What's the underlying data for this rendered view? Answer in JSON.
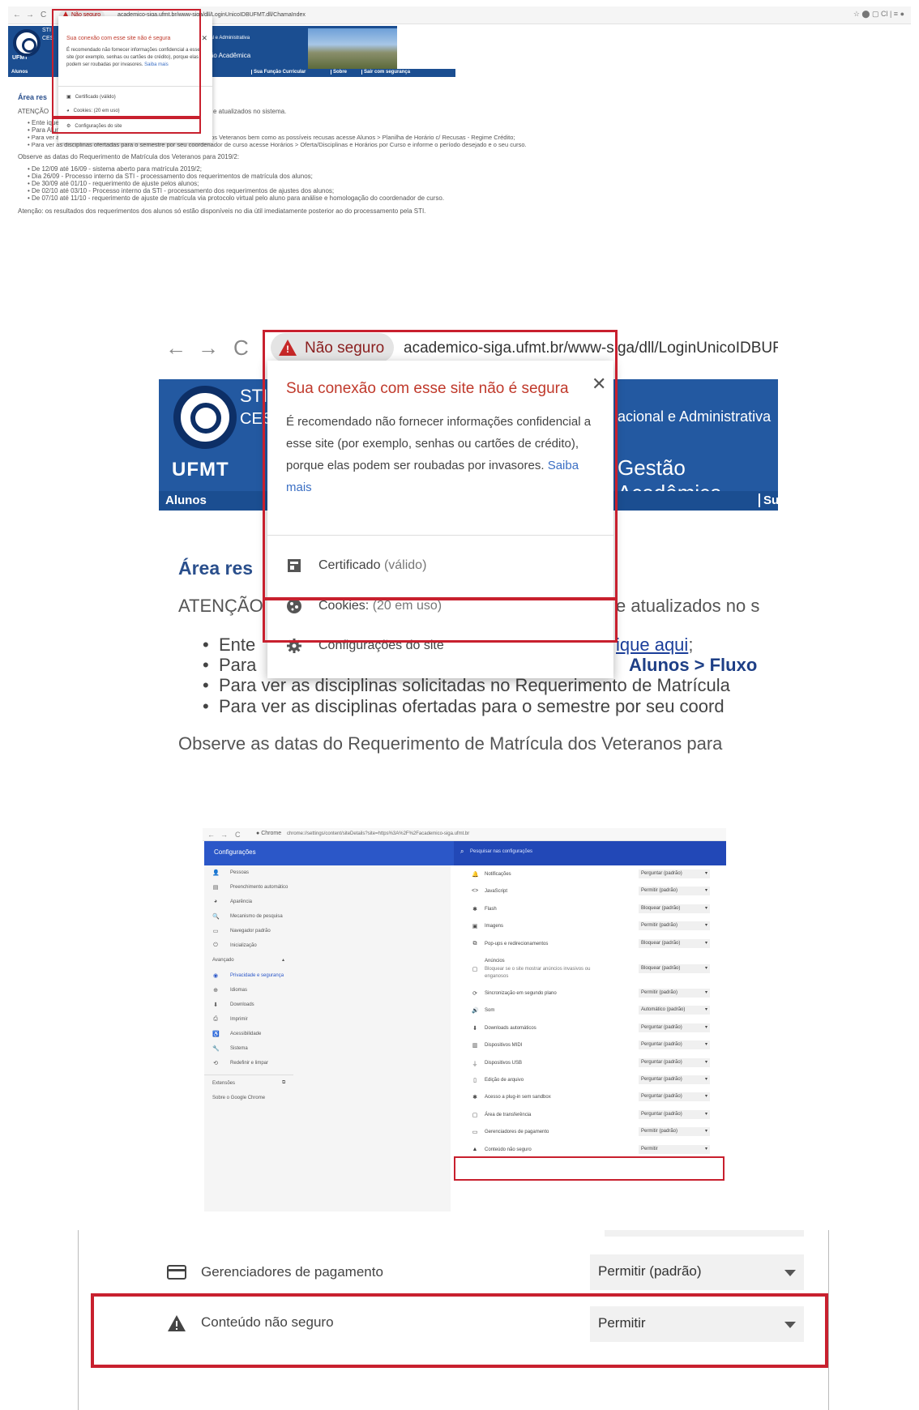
{
  "panel1": {
    "toolbar": {
      "nav": [
        "←",
        "→",
        "C"
      ],
      "not_secure": "Não seguro",
      "url": "academico-siga.ufmt.br/www-siga/dll/LoginUnicoIDBUFMT.dll/ChamaIndex",
      "right_icons": "☆  ⬤  ▢  Cl  |  ≡  ●"
    },
    "banner": {
      "sti": "STI",
      "ces": "CES",
      "ufmt": "UFMT",
      "admin": "cacional e Administrativa",
      "gestao": "Gestão Acadêmica"
    },
    "menubar": [
      "Alunos",
      "Sua Função Curricular",
      "Sobre",
      "Sair com segurança"
    ],
    "popup": {
      "title": "Sua conexão com esse site não é segura",
      "desc": "É recomendado não fornecer informações confidencial a esse site (por exemplo, senhas ou cartões de crédito), porque elas podem ser roubadas por invasores.",
      "more": "Saiba mais",
      "cert": "Certificado (válido)",
      "cookies": "Cookies: (20 em uso)",
      "settings": "Configurações do site"
    },
    "heading": "Área res",
    "atencao": "ATENÇÃO",
    "atencao_tail": "e atualizados no sistema.",
    "bullets": [
      "Ente                                       ique aqui;",
      "Para                                       Alunos > Fluxograma;",
      "Para ver as disciplinas solicitadas no Requerimento de Matrícula dos Veteranos bem como as possíveis recusas acesse Alunos > Planilha de Horário c/ Recusas - Regime Crédito;",
      "Para ver as disciplinas ofertadas para o semestre por seu coordenador de curso acesse Horários > Oferta/Disciplinas e Horários por Curso e informe o período desejado e o seu curso."
    ],
    "observe": "Observe as datas do Requerimento de Matrícula dos Veteranos para 2019/2:",
    "dates": [
      "De 12/09 até 16/09 - sistema aberto para matrícula 2019/2;",
      "Dia 26/09 - Processo interno da STI - processamento dos requerimentos de matrícula dos alunos;",
      "De 30/09 até 01/10 - requerimento de ajuste pelos alunos;",
      "De 02/10 até 03/10 - Processo interno da STI - processamento dos requerimentos de ajustes dos alunos;",
      "De 07/10 até 11/10 - requerimento de ajuste de matrícula via protocolo virtual pelo aluno para análise e homologação do coordenador de curso."
    ],
    "footer": "Atenção: os resultados dos requerimentos dos alunos só estão disponíveis no dia útil imediatamente posterior ao do processamento pela STI."
  },
  "panel2": {
    "nav": [
      "←",
      "→",
      "C"
    ],
    "not_secure": "Não seguro",
    "url": "academico-siga.ufmt.br/www-siga/dll/LoginUnicoIDBUF",
    "banner": {
      "sti": "STI",
      "ces": "CES",
      "ufmt": "UFMT",
      "admin": "acional e Administrativa",
      "gestao": "Gestão Acadêmica",
      "alunos": "Alunos",
      "su": "Su"
    },
    "popup": {
      "title": "Sua conexão com esse site não é segura",
      "desc": "É recomendado não fornecer informações confidencial a esse site (por exemplo, senhas ou cartões de crédito), porque elas podem ser roubadas por invasores.",
      "more": "Saiba mais",
      "cert_label": "Certificado",
      "cert_status": "(válido)",
      "cookies_label": "Cookies:",
      "cookies_status": "(20 em uso)",
      "settings": "Configurações do site"
    },
    "heading": "Área res",
    "atencao": "ATENÇÃO",
    "atencao_tail": "e atualizados no s",
    "bullet1_start": "Ente",
    "bullet1_link": "ique aqui",
    "bullet1_end": ";",
    "bullet2_start": "Para",
    "bullet2_bold": "Alunos > Fluxo",
    "bullet3": "Para ver as disciplinas solicitadas no Requerimento de Matrícula",
    "bullet4": "Para ver as disciplinas ofertadas para o semestre por seu coord",
    "observe": "Observe as datas do Requerimento de Matrícula dos Veteranos para"
  },
  "panel3": {
    "toolbar": {
      "nav": [
        "←",
        "→",
        "C"
      ],
      "chrome": "Chrome",
      "url": "chrome://settings/content/siteDetails?site=https%3A%2F%2Facademico-siga.ufmt.br"
    },
    "title": "Configurações",
    "search_placeholder": "Pesquisar nas configurações",
    "sidebar": [
      {
        "icon": "person-icon",
        "glyph": "👤",
        "label": "Pessoas"
      },
      {
        "icon": "autofill-icon",
        "glyph": "▤",
        "label": "Preenchimento automático"
      },
      {
        "icon": "palette-icon",
        "glyph": "◕",
        "label": "Aparência"
      },
      {
        "icon": "search-icon",
        "glyph": "🔍",
        "label": "Mecanismo de pesquisa"
      },
      {
        "icon": "browser-icon",
        "glyph": "▭",
        "label": "Navegador padrão"
      },
      {
        "icon": "power-icon",
        "glyph": "⏻",
        "label": "Inicialização"
      }
    ],
    "advanced": "Avançado",
    "advanced_items": [
      {
        "icon": "shield-icon",
        "glyph": "◉",
        "label": "Privacidade e segurança",
        "active": true
      },
      {
        "icon": "globe-icon",
        "glyph": "⊕",
        "label": "Idiomas"
      },
      {
        "icon": "download-icon",
        "glyph": "⬇",
        "label": "Downloads"
      },
      {
        "icon": "print-icon",
        "glyph": "⎙",
        "label": "Imprimir"
      },
      {
        "icon": "accessibility-icon",
        "glyph": "♿",
        "label": "Acessibilidade"
      },
      {
        "icon": "wrench-icon",
        "glyph": "🔧",
        "label": "Sistema"
      },
      {
        "icon": "restore-icon",
        "glyph": "⟲",
        "label": "Redefinir e limpar"
      }
    ],
    "extensions": "Extensões",
    "about": "Sobre o Google Chrome",
    "permissions": [
      {
        "icon": "bell-icon",
        "glyph": "🔔",
        "label": "Notificações",
        "value": "Perguntar (padrão)"
      },
      {
        "icon": "code-icon",
        "glyph": "<>",
        "label": "JavaScript",
        "value": "Permitir (padrão)"
      },
      {
        "icon": "puzzle-icon",
        "glyph": "✱",
        "label": "Flash",
        "value": "Bloquear (padrão)"
      },
      {
        "icon": "image-icon",
        "glyph": "▣",
        "label": "Imagens",
        "value": "Permitir (padrão)"
      },
      {
        "icon": "popup-icon",
        "glyph": "⧉",
        "label": "Pop-ups e redirecionamentos",
        "value": "Bloquear (padrão)"
      },
      {
        "icon": "ads-icon",
        "glyph": "▢",
        "label": "Anúncios",
        "sublabel": "Bloquear se o site mostrar anúncios invasivos ou enganosos",
        "value": "Bloquear (padrão)"
      },
      {
        "icon": "sync-icon",
        "glyph": "⟳",
        "label": "Sincronização em segundo plano",
        "value": "Permitir (padrão)"
      },
      {
        "icon": "sound-icon",
        "glyph": "🔊",
        "label": "Som",
        "value": "Automático (padrão)"
      },
      {
        "icon": "download-icon",
        "glyph": "⬇",
        "label": "Downloads automáticos",
        "value": "Perguntar (padrão)"
      },
      {
        "icon": "midi-icon",
        "glyph": "▥",
        "label": "Dispositivos MIDI",
        "value": "Perguntar (padrão)"
      },
      {
        "icon": "usb-icon",
        "glyph": "⏚",
        "label": "Dispositivos USB",
        "value": "Perguntar (padrão)"
      },
      {
        "icon": "file-edit-icon",
        "glyph": "▯",
        "label": "Edição de arquivo",
        "value": "Perguntar (padrão)"
      },
      {
        "icon": "plugin-icon",
        "glyph": "✱",
        "label": "Acesso a plug-in sem sandbox",
        "value": "Perguntar (padrão)"
      },
      {
        "icon": "clipboard-icon",
        "glyph": "▢",
        "label": "Área de transferência",
        "value": "Perguntar (padrão)"
      },
      {
        "icon": "payment-icon",
        "glyph": "▭",
        "label": "Gerenciadores de pagamento",
        "value": "Permitir (padrão)"
      },
      {
        "icon": "warning-icon",
        "glyph": "▲",
        "label": "Conteúdo não seguro",
        "value": "Permitir"
      }
    ]
  },
  "panel4": {
    "payment_label": "Gerenciadores de pagamento",
    "payment_value": "Permitir (padrão)",
    "insecure_label": "Conteúdo não seguro",
    "insecure_value": "Permitir"
  }
}
